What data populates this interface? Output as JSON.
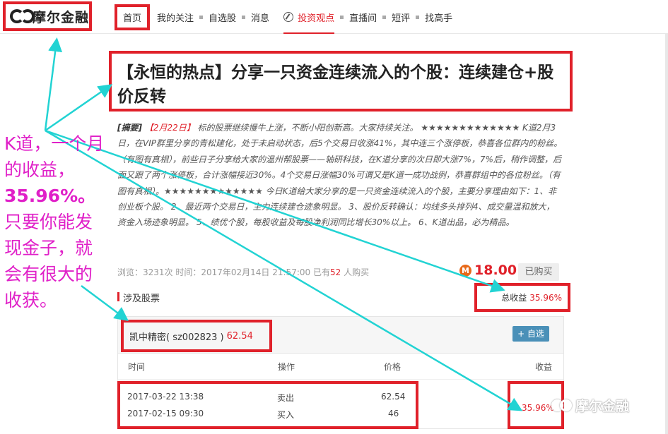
{
  "header": {
    "logo_text": "摩尔金融",
    "nav": {
      "home": "首页",
      "items": [
        "我的关注",
        "自选股",
        "消息"
      ],
      "active": "投资观点",
      "more": [
        "直播间",
        "短评",
        "找高手"
      ]
    }
  },
  "article": {
    "title": "【永恒的热点】分享一只资金连续流入的个股：连续建仓+股价反转",
    "summary_tag": "[摘要]",
    "summary_date": "【2月22日】",
    "summary_text": "标的股票继续慢牛上涨，不断小阳创新高。大家持续关注。 ★★★★★★★★★★★★★ K道2月3日，在VIP群里分享的青松建化，处于未启动状态，后5个交易日收涨41%，其中连三个涨停板，恭喜各位群内的粉丝。（有图有真相），前些日子分享给大家的温州帮股票——轴研科技，在K道分享的次日即大涨7%，7%后，稍作调整，后面又跟了两个涨停板，合计涨幅接近30%。4个交易日涨幅30%可谓又是K道一成功战例，恭喜群组中的各位粉丝。（有图有真相）。★★★★★★★★★★★★★ 今日K道给大家分享的是一只资金连续流入的个股，主要分享理由如下：1、非创业板个股。 2、最近两个交易日，主力连续建仓迹象明显。 3、股价反转确认：均线多头排列4、成交量温和放大，资金入场迹象明显。 5、绩优个股，每股收益及每股净利润同比增长30%以上。 6、K道出品，必为精品。",
    "meta_prefix": "浏览：3231次  时间：2017年02月14日 21:57:00  已有",
    "meta_count": "52",
    "meta_suffix": " 人购买",
    "price_icon": "M",
    "price": "18.00",
    "bought_label": "已购买",
    "total_label": "总收益",
    "total_value": "35.96%",
    "section_title": "涉及股票"
  },
  "stock": {
    "name": "凯中精密( sz002823 )",
    "price": "62.54",
    "add_label": "+ 自选",
    "headers": {
      "time": "时间",
      "op": "操作",
      "price": "价格",
      "gain": "收益"
    },
    "rows": [
      {
        "time": "2017-03-22 13:38",
        "op": "卖出",
        "price": "62.54"
      },
      {
        "time": "2017-02-15 09:30",
        "op": "买入",
        "price": "46"
      }
    ],
    "gain": "35.96%"
  },
  "watermark": "摩尔金融",
  "annotation": {
    "l1": "K道，一个月",
    "l2": "的收益，",
    "l3": "35.96%。",
    "l4": "只要你能发",
    "l5": "现金子，就",
    "l6": "会有很大的",
    "l7": "收获。"
  },
  "colors": {
    "accent": "#e0212a",
    "annotation": "#e020c8",
    "arrow": "#22d3d3",
    "button": "#4a90b8"
  }
}
